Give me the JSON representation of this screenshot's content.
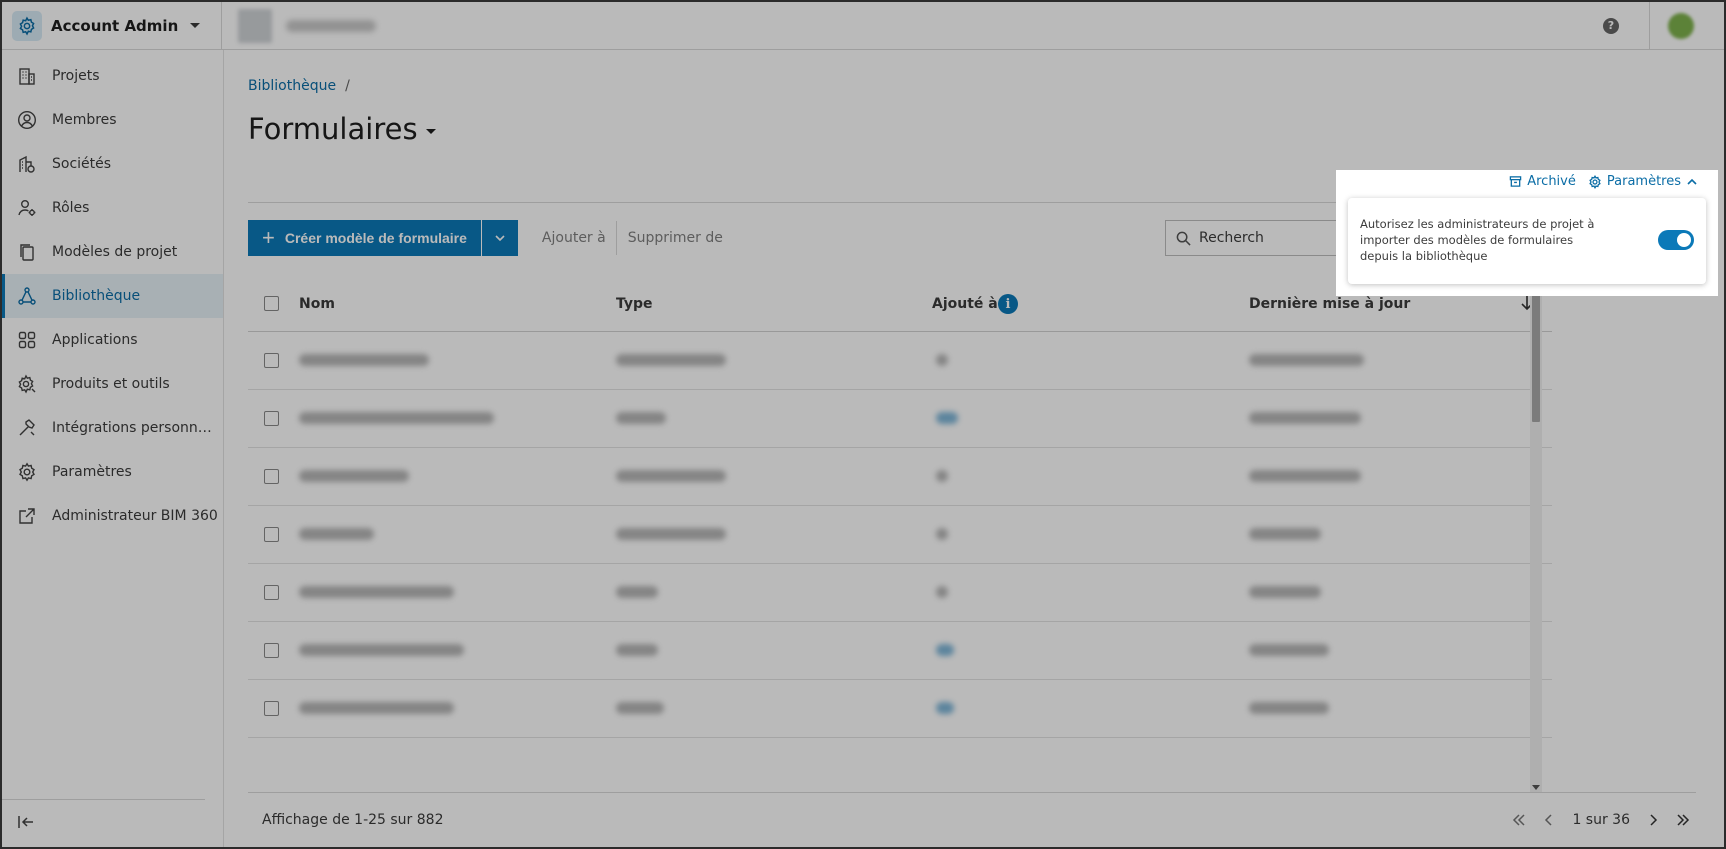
{
  "app": {
    "name": "Account Admin"
  },
  "sidebar": {
    "items": [
      {
        "label": "Projets",
        "icon": "building-icon"
      },
      {
        "label": "Membres",
        "icon": "member-icon"
      },
      {
        "label": "Sociétés",
        "icon": "company-icon"
      },
      {
        "label": "Rôles",
        "icon": "roles-icon"
      },
      {
        "label": "Modèles de projet",
        "icon": "template-icon"
      },
      {
        "label": "Bibliothèque",
        "icon": "library-icon",
        "active": true
      },
      {
        "label": "Applications",
        "icon": "grid-icon"
      },
      {
        "label": "Produits et outils",
        "icon": "tools-gear-icon"
      },
      {
        "label": "Intégrations personnalisées",
        "icon": "hammer-icon"
      },
      {
        "label": "Paramètres",
        "icon": "gear-icon"
      },
      {
        "label": "Administrateur BIM 360",
        "icon": "external-link-icon"
      }
    ]
  },
  "breadcrumb": {
    "root": "Bibliothèque",
    "separator": "/"
  },
  "page": {
    "title": "Formulaires"
  },
  "toolbar": {
    "create_label": "Créer modèle de formulaire",
    "add_to": "Ajouter à",
    "remove_from": "Supprimer de",
    "search_value": "Recherch"
  },
  "table": {
    "columns": {
      "name": "Nom",
      "type": "Type",
      "added_to": "Ajouté à",
      "updated": "Dernière mise à jour"
    }
  },
  "footer": {
    "showing": "Affichage de 1-25 sur 882",
    "page_label": "1 sur 36"
  },
  "popup": {
    "archive_label": "Archivé",
    "settings_label": "Paramètres",
    "setting_text": "Autorisez les administrateurs de projet à importer des modèles de formulaires depuis la bibliothèque",
    "toggle_on": true
  },
  "colors": {
    "accent": "#0b79b8",
    "link": "#0b6da6"
  }
}
